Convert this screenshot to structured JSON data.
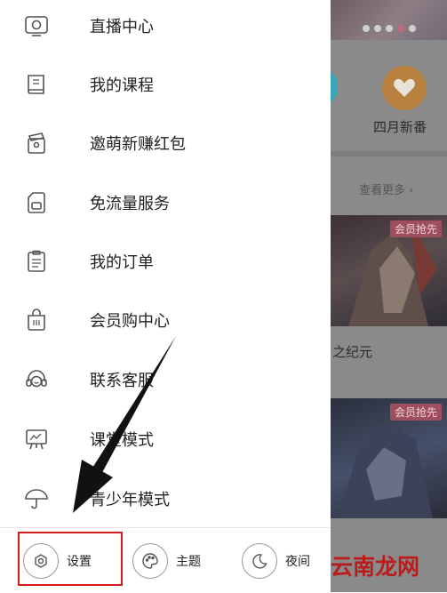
{
  "drawer": {
    "items": [
      {
        "label": "直播中心",
        "icon": "live-tv-icon"
      },
      {
        "label": "我的课程",
        "icon": "course-book-icon"
      },
      {
        "label": "邀萌新赚红包",
        "icon": "red-packet-icon"
      },
      {
        "label": "免流量服务",
        "icon": "sim-card-icon"
      },
      {
        "label": "我的订单",
        "icon": "order-list-icon"
      },
      {
        "label": "会员购中心",
        "icon": "shopping-bag-icon"
      },
      {
        "label": "联系客服",
        "icon": "headset-icon"
      },
      {
        "label": "课堂模式",
        "icon": "classroom-board-icon"
      },
      {
        "label": "青少年模式",
        "icon": "umbrella-icon"
      }
    ],
    "bottom": {
      "settings": "设置",
      "theme": "主题",
      "night": "夜间"
    }
  },
  "background": {
    "feature_label": "四月新番",
    "see_more": "查看更多",
    "badge1": "会员抢先",
    "card_title": "之纪元",
    "badge2": "会员抢先"
  },
  "watermark": "云南龙网",
  "colors": {
    "highlight": "#d41c1c",
    "badge": "#9e4e5e",
    "feature": "#b8813f",
    "watermark": "#bb1b1b"
  }
}
